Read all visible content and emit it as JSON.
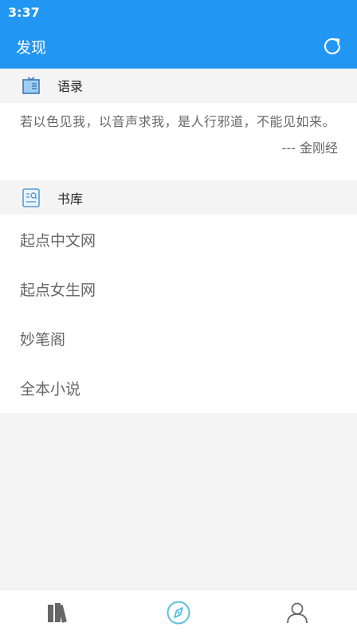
{
  "status_bar": {
    "time": "3:37"
  },
  "app_bar": {
    "title": "发现"
  },
  "quotes": {
    "header": "语录",
    "text": "若以色见我，以音声求我，是人行邪道，不能见如来。",
    "source": "--- 金刚经"
  },
  "library": {
    "header": "书库",
    "items": [
      {
        "label": "起点中文网"
      },
      {
        "label": "起点女生网"
      },
      {
        "label": "妙笔阁"
      },
      {
        "label": "全本小说"
      }
    ]
  },
  "bottom_nav": {
    "items": [
      {
        "icon": "bookshelf-icon"
      },
      {
        "icon": "compass-icon",
        "active": true
      },
      {
        "icon": "user-icon"
      }
    ]
  },
  "colors": {
    "primary": "#2196f3",
    "background": "#f4f4f4",
    "text_secondary": "#666666",
    "nav_active": "#5bc0de"
  }
}
